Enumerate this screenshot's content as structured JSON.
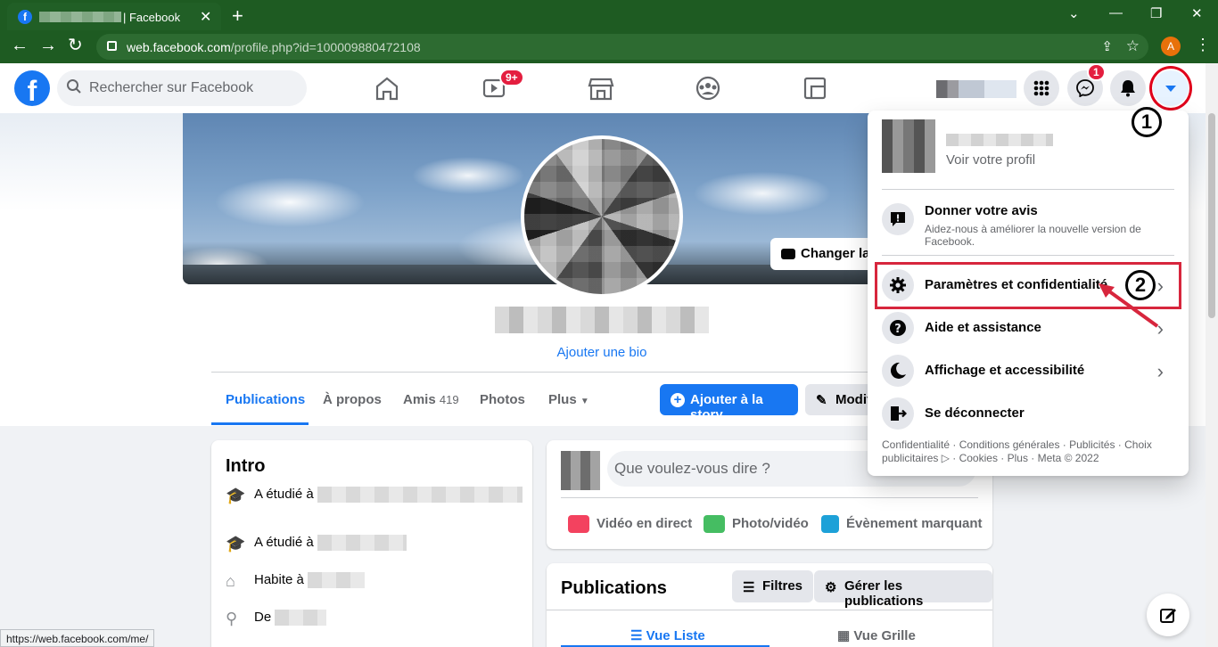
{
  "browser": {
    "tab_title": "| Facebook",
    "tab_close": "✕",
    "new_tab": "+",
    "url_domain": "web.facebook.com",
    "url_path": "/profile.php?id=100009880472108",
    "profile_initial": "A",
    "status_url": "https://web.facebook.com/me/",
    "accent": "#1e5b22"
  },
  "header": {
    "logo": "f",
    "search_placeholder": "Rechercher sur Facebook",
    "watch_badge": "9+",
    "messenger_badge": "1"
  },
  "profile": {
    "change_cover": "Changer la photo",
    "add_bio": "Ajouter une bio",
    "tabs": [
      {
        "label": "Publications"
      },
      {
        "label": "À propos"
      },
      {
        "label": "Amis",
        "count": "419"
      },
      {
        "label": "Photos"
      },
      {
        "label": "Plus"
      }
    ],
    "add_story": "Ajouter à la story",
    "edit_profile": "Modifier le profil"
  },
  "intro": {
    "title": "Intro",
    "rows": [
      "A étudié à",
      "A étudié à",
      "Habite à",
      "De"
    ]
  },
  "composer": {
    "placeholder": "Que voulez-vous dire ?",
    "actions": [
      "Vidéo en direct",
      "Photo/vidéo",
      "Évènement marquant"
    ]
  },
  "posts": {
    "title": "Publications",
    "filters": "Filtres",
    "manage": "Gérer les publications",
    "list_view": "Vue Liste",
    "grid_view": "Vue Grille"
  },
  "menu": {
    "see_profile": "Voir votre profil",
    "feedback_title": "Donner votre avis",
    "feedback_sub": "Aidez-nous à améliorer la nouvelle version de Facebook.",
    "settings": "Paramètres et confidentialité",
    "help": "Aide et assistance",
    "display": "Affichage et accessibilité",
    "logout": "Se déconnecter",
    "footer": "Confidentialité · Conditions générales · Publicités · Choix publicitaires ▷ · Cookies · Plus · Meta © 2022"
  },
  "annotations": {
    "step1": "1",
    "step2": "2",
    "highlight_color": "#d7263d"
  }
}
